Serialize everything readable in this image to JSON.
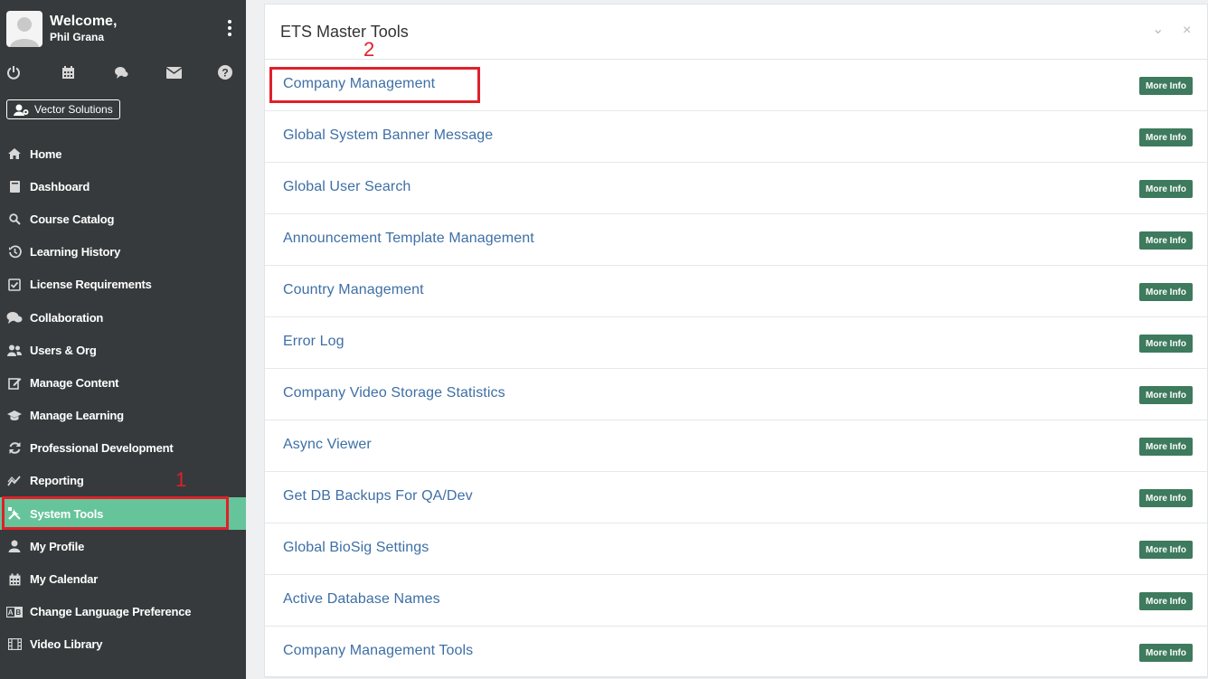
{
  "user": {
    "welcome": "Welcome,",
    "name": "Phil Grana"
  },
  "org_button": "Vector Solutions",
  "quick_icons": [
    "power-icon",
    "calendar-icon",
    "chat-icon",
    "mail-icon",
    "help-icon"
  ],
  "nav": [
    {
      "label": "Home",
      "icon": "home-icon"
    },
    {
      "label": "Dashboard",
      "icon": "book-icon"
    },
    {
      "label": "Course Catalog",
      "icon": "search-icon"
    },
    {
      "label": "Learning History",
      "icon": "history-icon"
    },
    {
      "label": "License Requirements",
      "icon": "checkbox-icon"
    },
    {
      "label": "Collaboration",
      "icon": "chat-icon"
    },
    {
      "label": "Users & Org",
      "icon": "users-icon"
    },
    {
      "label": "Manage Content",
      "icon": "edit-icon"
    },
    {
      "label": "Manage Learning",
      "icon": "graduation-cap-icon"
    },
    {
      "label": "Professional Development",
      "icon": "refresh-icon"
    },
    {
      "label": "Reporting",
      "icon": "chart-line-icon"
    },
    {
      "label": "System Tools",
      "icon": "tools-icon",
      "active": true
    },
    {
      "label": "My Profile",
      "icon": "user-icon"
    },
    {
      "label": "My Calendar",
      "icon": "calendar-icon"
    },
    {
      "label": "Change Language Preference",
      "icon": "language-icon"
    },
    {
      "label": "Video Library",
      "icon": "film-icon"
    }
  ],
  "annotations": {
    "first": "1",
    "second": "2"
  },
  "panel": {
    "title": "ETS Master Tools",
    "collapse_glyph": "⌄",
    "close_glyph": "×",
    "more_label": "More Info",
    "tools": [
      "Company Management",
      "Global System Banner Message",
      "Global User Search",
      "Announcement Template Management",
      "Country Management",
      "Error Log",
      "Company Video Storage Statistics",
      "Async Viewer",
      "Get DB Backups For QA/Dev",
      "Global BioSig Settings",
      "Active Database Names",
      "Company Management Tools"
    ]
  },
  "colors": {
    "sidebar": "#363a3c",
    "active": "#66c49a",
    "link": "#3e6fa6",
    "badge": "#3e7a5d",
    "annotation": "#e0202a"
  }
}
